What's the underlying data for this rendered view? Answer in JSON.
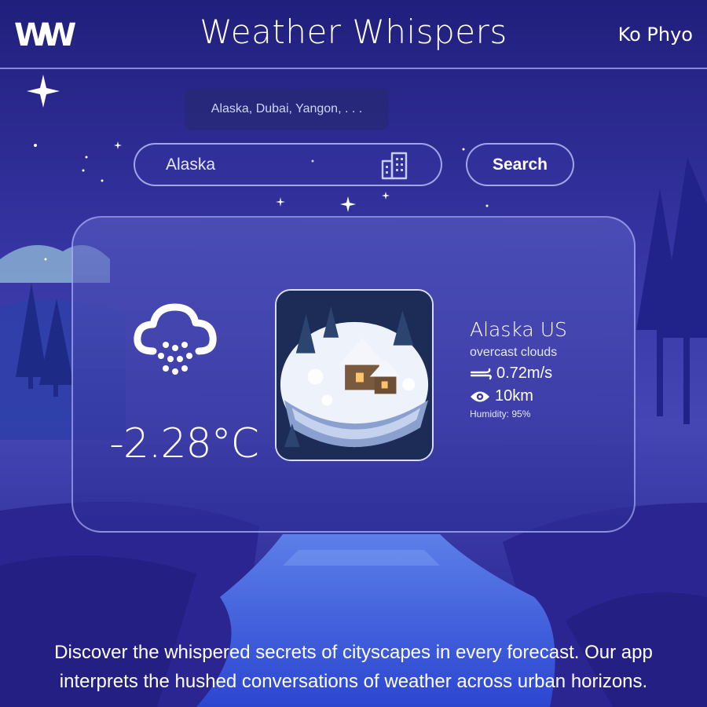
{
  "header": {
    "logo": "WW",
    "title": "Weather Whispers",
    "user": "Ko Phyo"
  },
  "search": {
    "suggestion": "Alaska, Dubai, Yangon, . . .",
    "value": "Alaska",
    "input_icon": "building-icon",
    "button_label": "Search"
  },
  "weather": {
    "icon": "snow-cloud-icon",
    "temperature": "-2.28°C",
    "location": "Alaska US",
    "condition": "overcast clouds",
    "wind": "0.72m/s",
    "wind_icon": "wind-icon",
    "visibility": "10km",
    "visibility_icon": "eye-icon",
    "humidity": "Humidity: 95%",
    "image": "snowy-cabin-island-illustration"
  },
  "footer": {
    "line1": "Discover the whispered secrets of cityscapes in every forecast. Our app",
    "line2": "interprets the hushed conversations of weather across urban horizons."
  },
  "colors": {
    "sky_top": "#22207f",
    "sky_mid": "#3a3aa8",
    "card_border": "#bec3ff",
    "text": "#ffffff"
  }
}
